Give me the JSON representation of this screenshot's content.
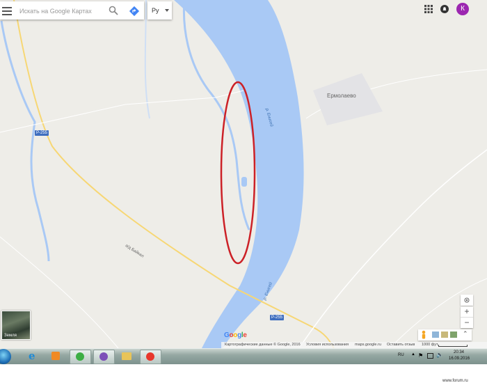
{
  "search": {
    "placeholder": "Искать на Google Картах"
  },
  "language": {
    "label": "Ру"
  },
  "account": {
    "initial": "К"
  },
  "map": {
    "place_label": "Ермолаево",
    "river_label_1": "р. Енисей",
    "river_label_2": "р. Енисей",
    "road_label_1": "Р-255",
    "road_label_2": "Р-255",
    "road_label_baikal": "а/д Байкал"
  },
  "earth_label": "Земля",
  "footer": {
    "attribution": "Картографические данные © Google, 2016",
    "terms": "Условия использования",
    "site": "maps.google.ru",
    "feedback": "Оставить отзыв",
    "scale": "1000 фут."
  },
  "google_logo": [
    "G",
    "o",
    "o",
    "g",
    "l",
    "e"
  ],
  "taskbar": {
    "lang": "RU",
    "time": "20:34",
    "date": "16.09.2016"
  },
  "watermark": "www.forum.ru",
  "colors": {
    "land": "#eeede8",
    "river": "#a9c9f5",
    "highlight": "#cc2127",
    "road": "#f7d774",
    "avatar": "#9c27b0"
  }
}
